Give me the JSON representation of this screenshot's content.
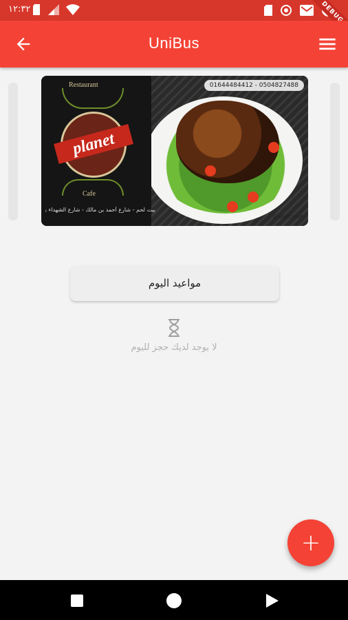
{
  "status_bar": {
    "time": "١٢:٣٢",
    "debug_label": "DEBUG"
  },
  "app_bar": {
    "title": "UniBus"
  },
  "banner": {
    "logo_top": "Restaurant",
    "logo_word": "planet",
    "logo_bottom": "Cafe",
    "phone": "01644484412 - 0504827488",
    "address": "بيت لحم - شارع أحمد بن مالك - شارع الشهداء بجوار فندق إيمان",
    "instagram": "planet.rest"
  },
  "today_button": {
    "label": "مواعيد اليوم"
  },
  "empty_state": {
    "icon": "hourglass-icon",
    "message": "لا يوجد لديك حجز لليوم"
  },
  "fab": {
    "label": "+"
  },
  "colors": {
    "primary": "#f44336",
    "status_bar": "#d7372b",
    "background": "#f3f3f3"
  }
}
